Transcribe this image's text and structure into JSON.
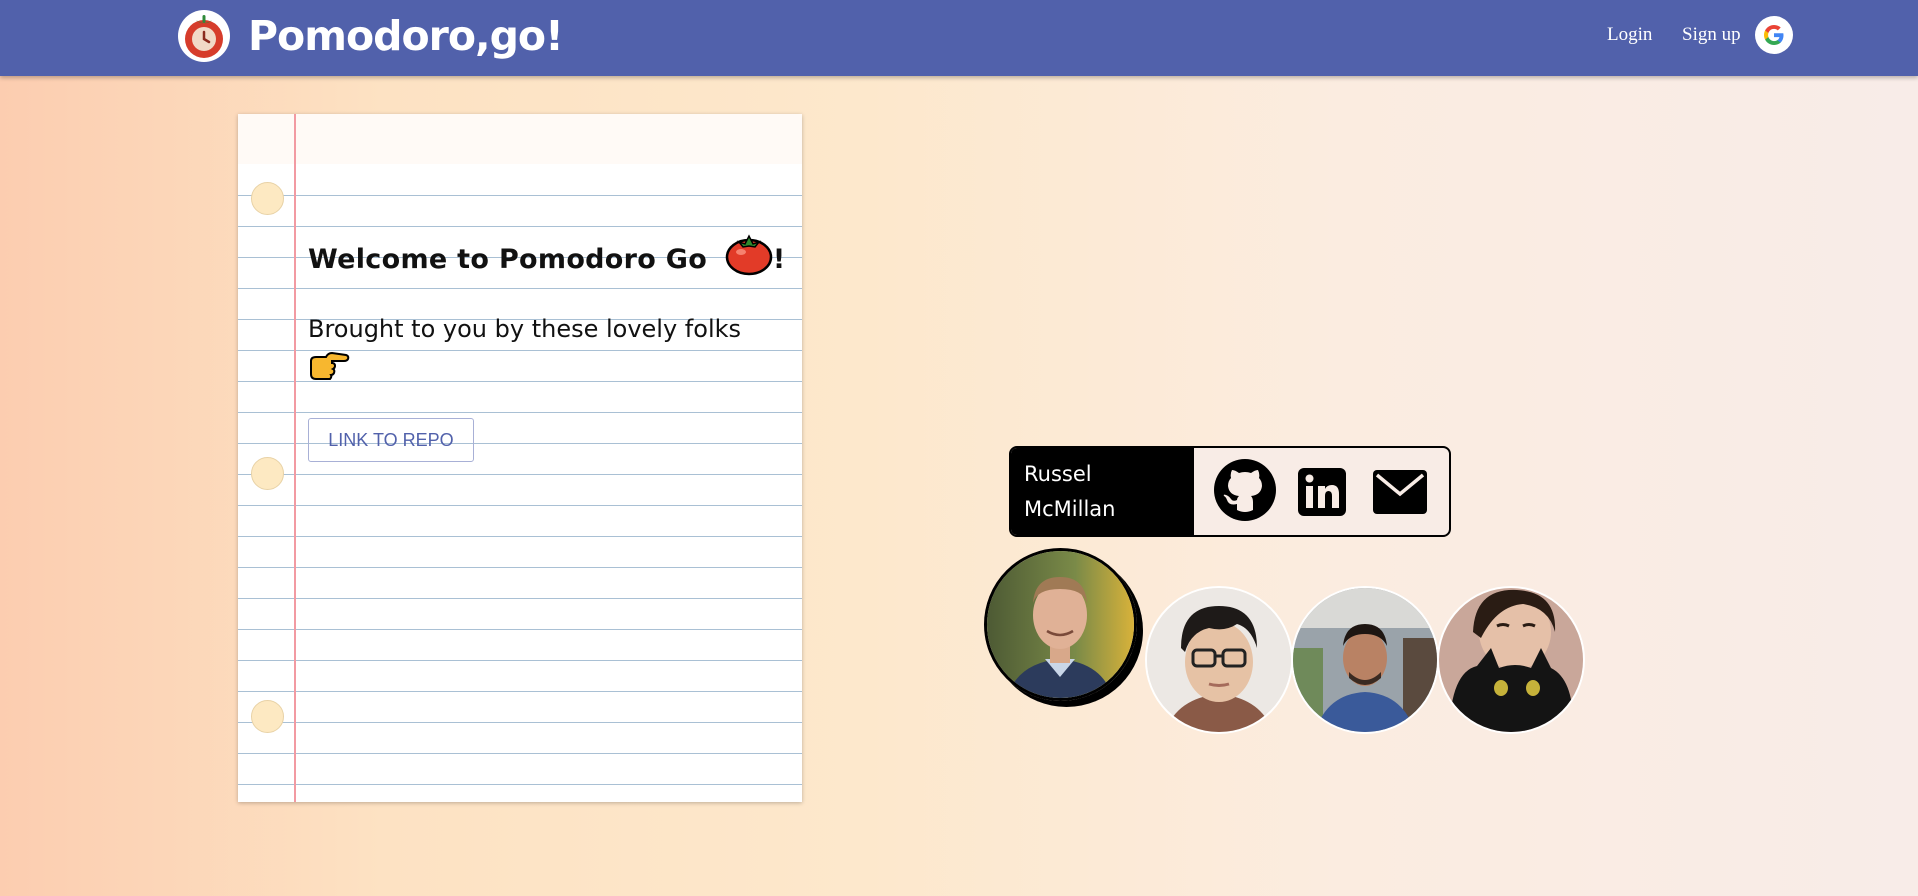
{
  "header": {
    "brand": "Pomodoro,go!",
    "login_label": "Login",
    "signup_label": "Sign up",
    "google_icon": "google-icon"
  },
  "notebook": {
    "title": "Welcome to Pomodoro Go",
    "title_suffix": "!",
    "subtitle": "Brought to you by these lovely folks",
    "repo_button": "LINK TO REPO"
  },
  "contact_card": {
    "name_first": "Russel",
    "name_last": "McMillan",
    "icons": [
      "github-icon",
      "linkedin-icon",
      "mail-icon"
    ]
  },
  "team": [
    {
      "selected": true
    },
    {
      "selected": false
    },
    {
      "selected": false
    },
    {
      "selected": false
    }
  ],
  "colors": {
    "navbar": "#5161ab",
    "accent": "#5161ab",
    "margin_line": "#f29aa2"
  }
}
